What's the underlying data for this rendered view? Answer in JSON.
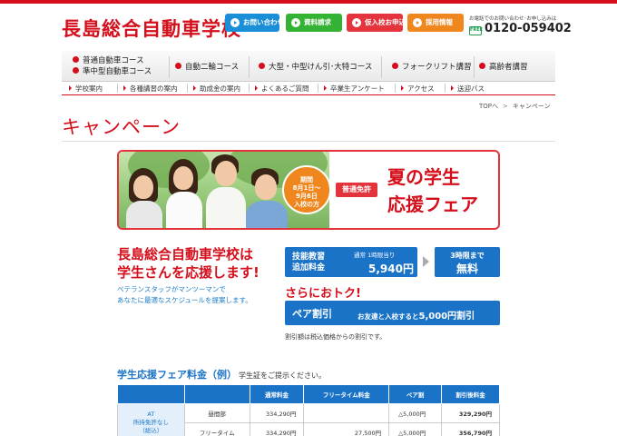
{
  "header": {
    "logo": "長島総合自動車学校",
    "buttons": [
      "お問い合わせ",
      "資料請求",
      "仮入校お申込",
      "採用情報"
    ],
    "phone_caption": "お電話でのお問い合わせ･お申し込みは",
    "phone_icon_label": "FREE",
    "phone": "0120-059402",
    "colors": {
      "brand_red": "#d40f1b",
      "blue": "#1a8fd8",
      "green": "#34b233",
      "red": "#e4343d",
      "orange": "#f0871e"
    }
  },
  "course_nav": {
    "items": [
      "普通自動車コース",
      "準中型自動車コース",
      "自動二輪コース",
      "大型・中型けん引･大特コース",
      "フォークリフト講習",
      "高齢者講習"
    ]
  },
  "sub_nav": {
    "items": [
      "学校案内",
      "各種講習の案内",
      "助成金の案内",
      "よくあるご質問",
      "卒業生アンケート",
      "アクセス",
      "送迎バス"
    ]
  },
  "breadcrumb": {
    "home": "TOPへ",
    "separator": ">",
    "current": "キャンペーン"
  },
  "page_title": "キャンペーン",
  "banner": {
    "period": [
      "期間",
      "8月1日～",
      "9月6日",
      "入校の方"
    ],
    "badge": "普通免許",
    "title_line1": "夏の学生",
    "title_line2": "応援フェア"
  },
  "support": {
    "line1": "長島総合自動車学校は",
    "line2": "学生さんを応援します!",
    "desc1": "ベテランスタッフがマンツーマンで",
    "desc2": "あなたに最適なスケジュールを提案します。"
  },
  "promo": {
    "label1": "技能教習",
    "label2": "追加料金",
    "sub": "通常 1時限当り",
    "price": "5,940円",
    "free_top": "3時限まで",
    "free_bottom": "無料",
    "more": "さらにおトク!",
    "pair_label": "ペア割引",
    "pair_text": "お友達と入校すると",
    "pair_amount": "5,000円割引",
    "note": "割引額は税込価格からの割引です。"
  },
  "table": {
    "title": "学生応援フェア料金（例）",
    "subtitle": "学生証をご提示ください。",
    "headers": [
      "",
      "",
      "通常料金",
      "フリータイム料金",
      "ペア割",
      "割引後料金"
    ],
    "row_head": [
      "AT",
      "所持免許なし",
      "（総込）"
    ],
    "rows": [
      [
        "昼間部",
        "334,290円",
        "",
        "△5,000円",
        "329,290円"
      ],
      [
        "フリータイム",
        "334,290円",
        "27,500円",
        "△5,000円",
        "356,790円"
      ]
    ]
  }
}
